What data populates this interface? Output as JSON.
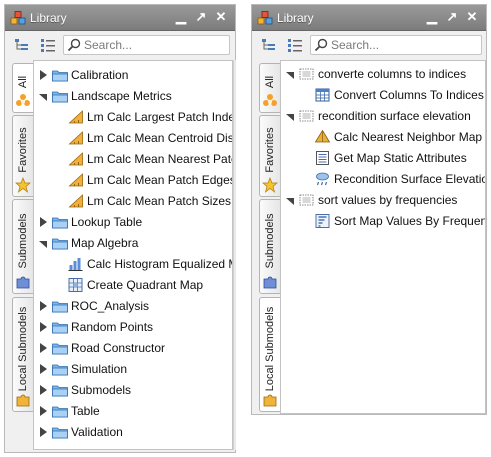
{
  "panelA": {
    "title": "Library",
    "search_placeholder": "Search...",
    "tabs": [
      "All",
      "Favorites",
      "Submodels",
      "Local Submodels"
    ],
    "tree": [
      {
        "label": "Calibration",
        "icon": "folder-icon",
        "arrow": "collapsed",
        "level": 0
      },
      {
        "label": "Landscape Metrics",
        "icon": "folder-icon",
        "arrow": "expanded",
        "level": 0
      },
      {
        "label": "Lm Calc Largest Patch Index",
        "icon": "ruler-icon",
        "arrow": "none",
        "level": 1
      },
      {
        "label": "Lm Calc Mean Centroid Distan",
        "icon": "ruler-icon",
        "arrow": "none",
        "level": 1
      },
      {
        "label": "Lm Calc Mean Nearest Patch D",
        "icon": "ruler-icon",
        "arrow": "none",
        "level": 1
      },
      {
        "label": "Lm Calc Mean Patch Edges An",
        "icon": "ruler-icon",
        "arrow": "none",
        "level": 1
      },
      {
        "label": "Lm Calc Mean Patch Sizes And",
        "icon": "ruler-icon",
        "arrow": "none",
        "level": 1
      },
      {
        "label": "Lookup Table",
        "icon": "folder-icon",
        "arrow": "collapsed",
        "level": 0
      },
      {
        "label": "Map Algebra",
        "icon": "folder-icon",
        "arrow": "expanded",
        "level": 0
      },
      {
        "label": "Calc Histogram Equalized Map",
        "icon": "histogram-icon",
        "arrow": "none",
        "level": 1
      },
      {
        "label": "Create Quadrant Map",
        "icon": "grid-map-icon",
        "arrow": "none",
        "level": 1
      },
      {
        "label": "ROC_Analysis",
        "icon": "folder-icon",
        "arrow": "collapsed",
        "level": 0
      },
      {
        "label": "Random Points",
        "icon": "folder-icon",
        "arrow": "collapsed",
        "level": 0
      },
      {
        "label": "Road Constructor",
        "icon": "folder-icon",
        "arrow": "collapsed",
        "level": 0
      },
      {
        "label": "Simulation",
        "icon": "folder-icon",
        "arrow": "collapsed",
        "level": 0
      },
      {
        "label": "Submodels",
        "icon": "folder-icon",
        "arrow": "collapsed",
        "level": 0
      },
      {
        "label": "Table",
        "icon": "folder-icon",
        "arrow": "collapsed",
        "level": 0
      },
      {
        "label": "Validation",
        "icon": "folder-icon",
        "arrow": "collapsed",
        "level": 0
      }
    ]
  },
  "panelB": {
    "title": "Library",
    "search_placeholder": "Search...",
    "tabs": [
      "All",
      "Favorites",
      "Submodels",
      "Local Submodels"
    ],
    "tree": [
      {
        "label": "converte columns to indices",
        "icon": "submodel-icon",
        "arrow": "expanded",
        "level": 0
      },
      {
        "label": "Convert Columns To Indices",
        "icon": "table-functor-icon",
        "arrow": "none",
        "level": 1
      },
      {
        "label": "recondition surface elevation",
        "icon": "submodel-icon",
        "arrow": "expanded",
        "level": 0
      },
      {
        "label": "Calc Nearest Neighbor Map",
        "icon": "pyramid-icon",
        "arrow": "none",
        "level": 1
      },
      {
        "label": "Get Map Static Attributes",
        "icon": "list-icon",
        "arrow": "none",
        "level": 1
      },
      {
        "label": "Recondition Surface Elevation",
        "icon": "rain-icon",
        "arrow": "none",
        "level": 1
      },
      {
        "label": "sort values by frequencies",
        "icon": "submodel-icon",
        "arrow": "expanded",
        "level": 0
      },
      {
        "label": "Sort Map Values By Frequency",
        "icon": "sort-icon",
        "arrow": "none",
        "level": 1
      }
    ]
  }
}
